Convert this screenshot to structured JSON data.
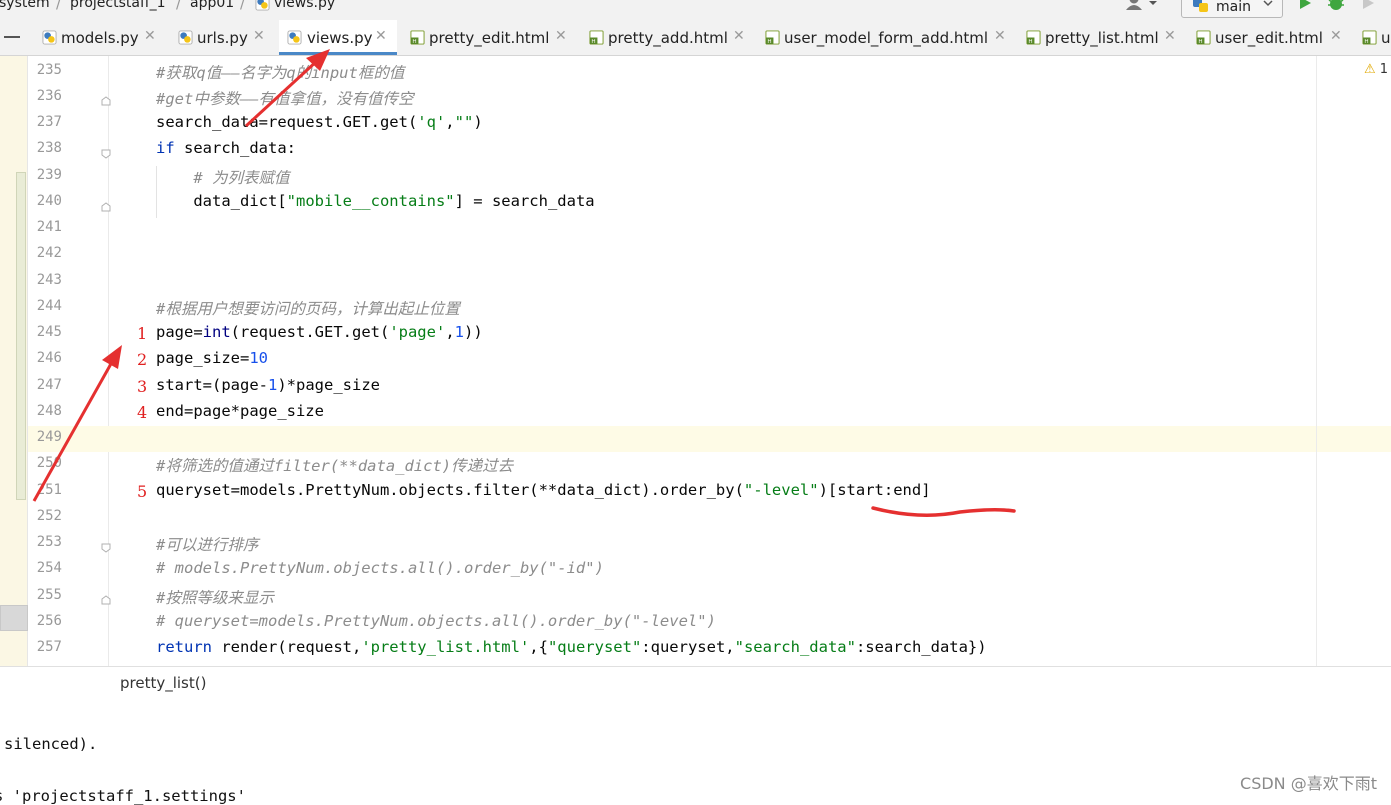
{
  "nav": {
    "crumbs": [
      "system",
      "projectstaff_1",
      "app01",
      "views.py"
    ],
    "branch": "main"
  },
  "tabs": [
    {
      "label": "models.py",
      "type": "py",
      "active": false
    },
    {
      "label": "urls.py",
      "type": "py",
      "active": false
    },
    {
      "label": "views.py",
      "type": "py",
      "active": true
    },
    {
      "label": "pretty_edit.html",
      "type": "html",
      "active": false
    },
    {
      "label": "pretty_add.html",
      "type": "html",
      "active": false
    },
    {
      "label": "user_model_form_add.html",
      "type": "html",
      "active": false
    },
    {
      "label": "pretty_list.html",
      "type": "html",
      "active": false
    },
    {
      "label": "user_edit.html",
      "type": "html",
      "active": false
    },
    {
      "label": "u",
      "type": "html",
      "active": false
    }
  ],
  "editor": {
    "warning_count": "1",
    "line_numbers": [
      "235",
      "236",
      "237",
      "238",
      "239",
      "240",
      "241",
      "242",
      "243",
      "244",
      "245",
      "246",
      "247",
      "248",
      "249",
      "250",
      "251",
      "252",
      "253",
      "254",
      "255",
      "256",
      "257"
    ],
    "markers": [
      "1",
      "2",
      "3",
      "4",
      "5"
    ]
  },
  "breadcrumb_function": "pretty_list()",
  "terminal": {
    "lines": [
      "silenced).",
      "s 'projectstaff_1.settings'"
    ]
  },
  "watermark": "CSDN @喜欢下雨t",
  "colors": {
    "accent": "#4a88c7",
    "annotation": "#e02020"
  }
}
